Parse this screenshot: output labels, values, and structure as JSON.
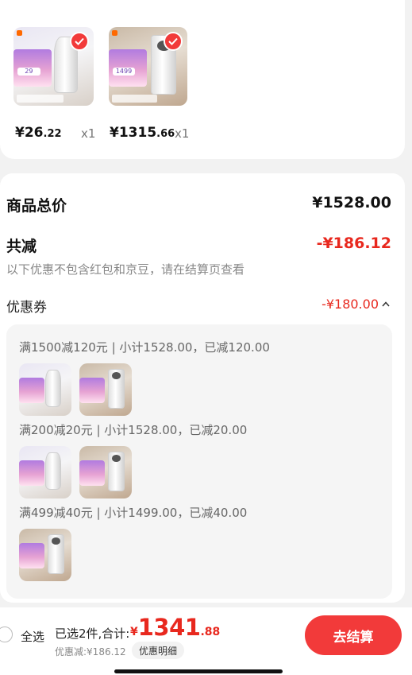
{
  "items": [
    {
      "price_int": "¥26",
      "price_dec": ".22",
      "qty": "x1",
      "selected": true,
      "promo_price": "29",
      "product": "cylinder-purifier"
    },
    {
      "price_int": "¥1315",
      "price_dec": ".66",
      "qty": "x1",
      "selected": true,
      "promo_price": "1499",
      "product": "box-purifier"
    }
  ],
  "summary": {
    "total_label": "商品总价",
    "total_value": "¥1528.00",
    "reduce_label": "共减",
    "reduce_value": "-¥186.12",
    "note": "以下优惠不包含红包和京豆，请在结算页查看",
    "coupon_label": "优惠券",
    "coupon_value": "-¥180.00"
  },
  "coupon_rules": [
    {
      "text": "满1500减120元 | 小计1528.00，已减120.00"
    },
    {
      "text": "满200减20元 | 小计1528.00，已减20.00"
    },
    {
      "text": "满499减40元 | 小计1499.00，已减40.00"
    }
  ],
  "footer": {
    "select_all": "全选",
    "selected_count": "已选2件,合计:",
    "total_yen": "¥",
    "total_int": "1341",
    "total_dec": ".88",
    "discount": "优惠减:¥186.12",
    "detail_button": "优惠明细",
    "checkout": "去结算"
  },
  "colors": {
    "accent": "#e8281e",
    "button": "#f23a3a",
    "promo": "#b17be0"
  }
}
